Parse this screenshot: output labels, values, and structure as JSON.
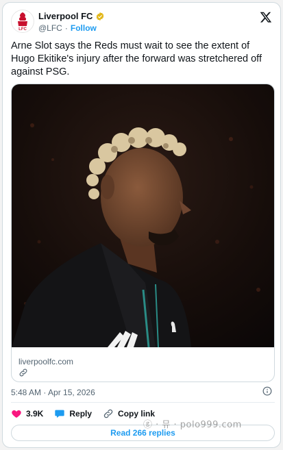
{
  "author": {
    "display_name": "Liverpool FC",
    "handle": "@LFC",
    "separator": "·",
    "follow_label": "Follow",
    "avatar_text": "LFC"
  },
  "tweet": {
    "text": "Arne Slot says the Reds must wait to see the extent of Hugo Ekitike's injury after the forward was stretchered off against PSG.",
    "link_domain": "liverpoolfc.com",
    "timestamp": "5:48 AM · Apr 15, 2026"
  },
  "actions": {
    "likes": "3.9K",
    "reply_label": "Reply",
    "copy_link_label": "Copy link",
    "read_replies_label": "Read 266 replies"
  },
  "watermark": "ⓖ · 뮤 · polo999.com",
  "colors": {
    "accent": "#1d9bf0",
    "like": "#f91880",
    "lfc_red": "#c8102e"
  },
  "icons": [
    "verified-badge-icon",
    "x-logo-icon",
    "link-icon",
    "info-icon",
    "heart-icon",
    "reply-bubble-icon",
    "copy-link-icon"
  ]
}
